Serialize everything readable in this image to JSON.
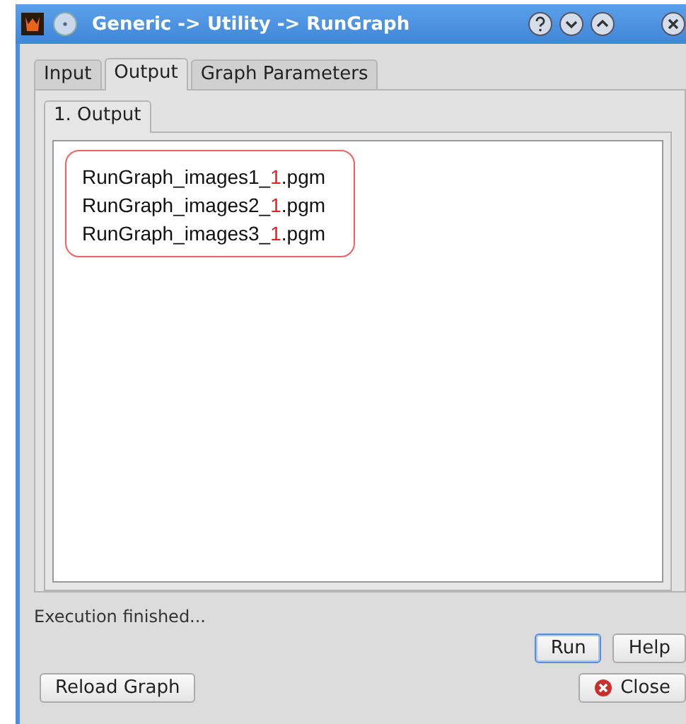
{
  "window": {
    "title": "Generic -> Utility -> RunGraph"
  },
  "tabs": [
    {
      "label": "Input",
      "selected": false
    },
    {
      "label": "Output",
      "selected": true
    },
    {
      "label": "Graph Parameters",
      "selected": false
    }
  ],
  "subtabs": [
    {
      "label": "1. Output",
      "selected": true
    }
  ],
  "outputs": [
    {
      "prefix": "RunGraph_images1_",
      "highlight": "1",
      "suffix": ".pgm"
    },
    {
      "prefix": "RunGraph_images2_",
      "highlight": "1",
      "suffix": ".pgm"
    },
    {
      "prefix": "RunGraph_images3_",
      "highlight": "1",
      "suffix": ".pgm"
    }
  ],
  "status": "Execution finished...",
  "buttons": [
    {
      "label": "Run",
      "kind": "default"
    },
    {
      "label": "Help",
      "kind": "plain"
    },
    {
      "label": "Reload Graph",
      "kind": "plain"
    },
    {
      "label": "Close",
      "kind": "close"
    }
  ]
}
